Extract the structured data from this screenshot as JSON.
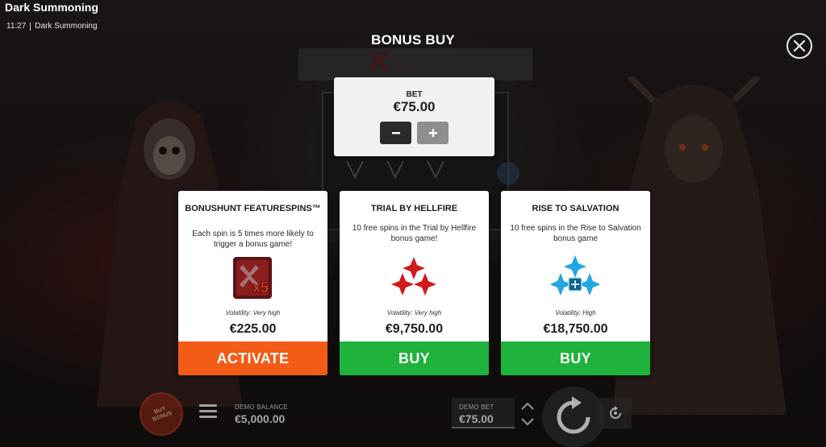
{
  "app": {
    "title": "Dark Summoning",
    "time": "11:27",
    "game_name": "Dark Summoning"
  },
  "modal": {
    "title": "BONUS BUY",
    "bet": {
      "label": "BET",
      "value": "€75.00",
      "minus_label": "−",
      "plus_label": "+"
    },
    "options": [
      {
        "title": "BONUSHUNT FEATURESPINS™",
        "description": "Each spin is 5 times more likely to trigger a bonus game!",
        "icon": "x5-multiplier-icon",
        "volatility": "Volatility: Very high",
        "price": "€225.00",
        "action": "ACTIVATE",
        "action_color": "#f25c17"
      },
      {
        "title": "TRIAL BY HELLFIRE",
        "description": "10 free spins in the Trial by Hellfire bonus game!",
        "icon": "red-crosses-icon",
        "volatility": "Volatility: Very high",
        "price": "€9,750.00",
        "action": "BUY",
        "action_color": "#1fb23c"
      },
      {
        "title": "RISE TO SALVATION",
        "description": "10 free spins in the Rise to Salvation bonus game",
        "icon": "blue-crosses-icon",
        "volatility": "Volatility: High",
        "price": "€18,750.00",
        "action": "BUY",
        "action_color": "#1fb23c"
      }
    ]
  },
  "hud": {
    "buy_bonus_label": "BUY BONUS",
    "balance_label": "DEMO BALANCE",
    "balance_value": "€5,000.00",
    "bet_label": "DEMO BET",
    "bet_value": "€75.00"
  },
  "colors": {
    "activate": "#f25c17",
    "buy": "#1fb23c",
    "bet_box": "#f1f1f1"
  }
}
